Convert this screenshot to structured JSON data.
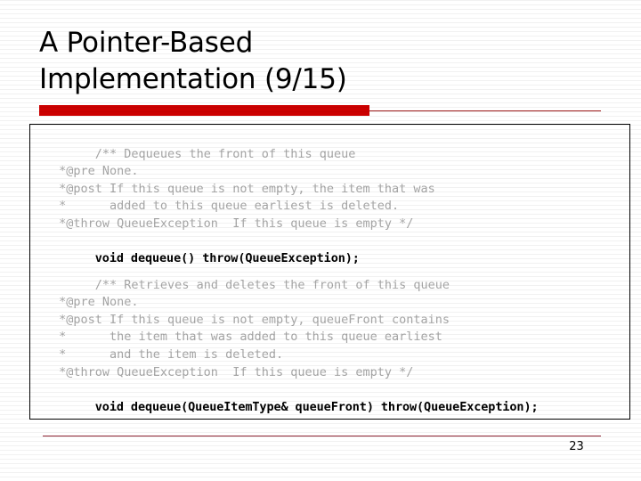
{
  "slide": {
    "title": "A Pointer-Based\nImplementation (9/15)",
    "page_number": "23",
    "accent_color": "#cc0000",
    "rule_color": "#8e2533",
    "comment_color": "#a6a6a6",
    "code_color": "#000000"
  },
  "code": {
    "block1": {
      "comment": "/** Dequeues the front of this queue\n *@pre None.\n *@post If this queue is not empty, the item that was\n *      added to this queue earliest is deleted.\n *@throw QueueException  If this queue is empty */",
      "declaration": "void dequeue() throw(QueueException);"
    },
    "block2": {
      "comment": "/** Retrieves and deletes the front of this queue\n *@pre None.\n *@post If this queue is not empty, queueFront contains\n *      the item that was added to this queue earliest\n *      and the item is deleted.\n *@throw QueueException  If this queue is empty */",
      "declaration": "void dequeue(QueueItemType& queueFront) throw(QueueException);"
    }
  }
}
